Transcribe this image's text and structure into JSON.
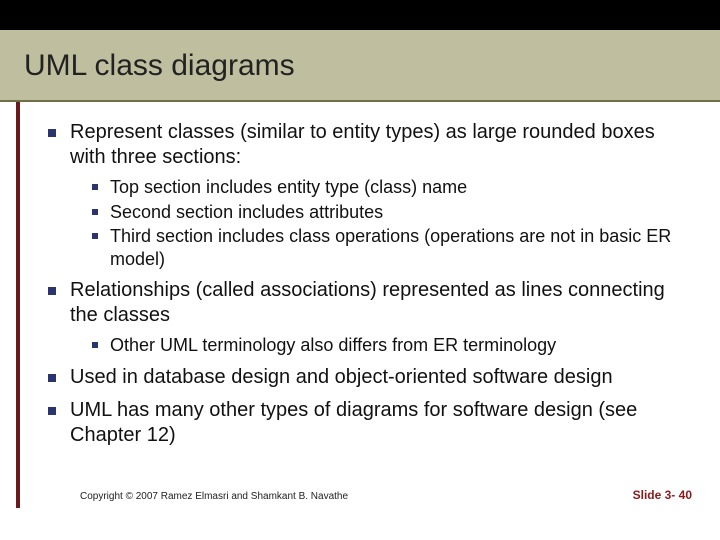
{
  "title": "UML class diagrams",
  "bullets": {
    "b1": "Represent classes (similar to entity types) as large rounded boxes with three sections:",
    "b1_sub": {
      "s1": "Top section includes entity type (class) name",
      "s2": "Second section includes attributes",
      "s3": "Third section includes class operations (operations are not in basic ER model)"
    },
    "b2": "Relationships (called associations) represented as lines connecting the classes",
    "b2_sub": {
      "s1": "Other UML terminology also differs from ER terminology"
    },
    "b3": "Used in database design and object-oriented software design",
    "b4": "UML has many other types of diagrams for software design (see Chapter 12)"
  },
  "footer": {
    "copyright": "Copyright © 2007 Ramez Elmasri and Shamkant B. Navathe",
    "slide": "Slide 3- 40"
  }
}
